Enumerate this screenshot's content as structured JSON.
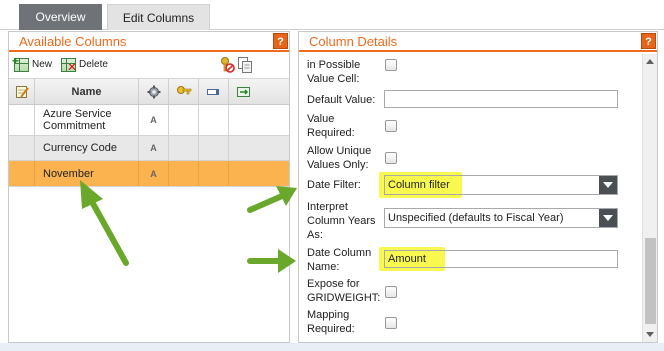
{
  "tabs": [
    {
      "label": "Overview",
      "active": false
    },
    {
      "label": "Edit Columns",
      "active": true
    }
  ],
  "left_panel": {
    "title": "Available Columns",
    "help": "?",
    "toolbar": {
      "new_label": "New",
      "delete_label": "Delete"
    },
    "columns": [
      "Name"
    ],
    "rows": [
      {
        "name": "Azure Service Commitment",
        "type": "A",
        "state": "normal"
      },
      {
        "name": "Currency Code",
        "type": "A",
        "state": "alternate"
      },
      {
        "name": "November",
        "type": "A",
        "state": "selected"
      }
    ]
  },
  "right_panel": {
    "title": "Column Details",
    "help": "?",
    "fields": {
      "in_possible_value_cell": {
        "label": "in Possible Value Cell:",
        "checked": false
      },
      "default_value": {
        "label": "Default Value:",
        "value": ""
      },
      "value_required": {
        "label": "Value Required:",
        "checked": false
      },
      "allow_unique_values_only": {
        "label": "Allow Unique Values Only:",
        "checked": false
      },
      "date_filter": {
        "label": "Date Filter:",
        "value": "Column filter"
      },
      "interpret_column_years_as": {
        "label": "Interpret Column Years As:",
        "value": "Unspecified (defaults to Fiscal Year)"
      },
      "date_column_name": {
        "label": "Date Column Name:",
        "value": "Amount"
      },
      "expose_for_gridweight": {
        "label": "Expose for GRIDWEIGHT:",
        "checked": false
      },
      "mapping_required": {
        "label": "Mapping Required:",
        "checked": false
      }
    }
  },
  "colors": {
    "accent_orange": "#ee6a1e",
    "selected_row": "#fbb350",
    "highlight_yellow": "#f7f730",
    "annotation_green": "#6aa82b"
  }
}
